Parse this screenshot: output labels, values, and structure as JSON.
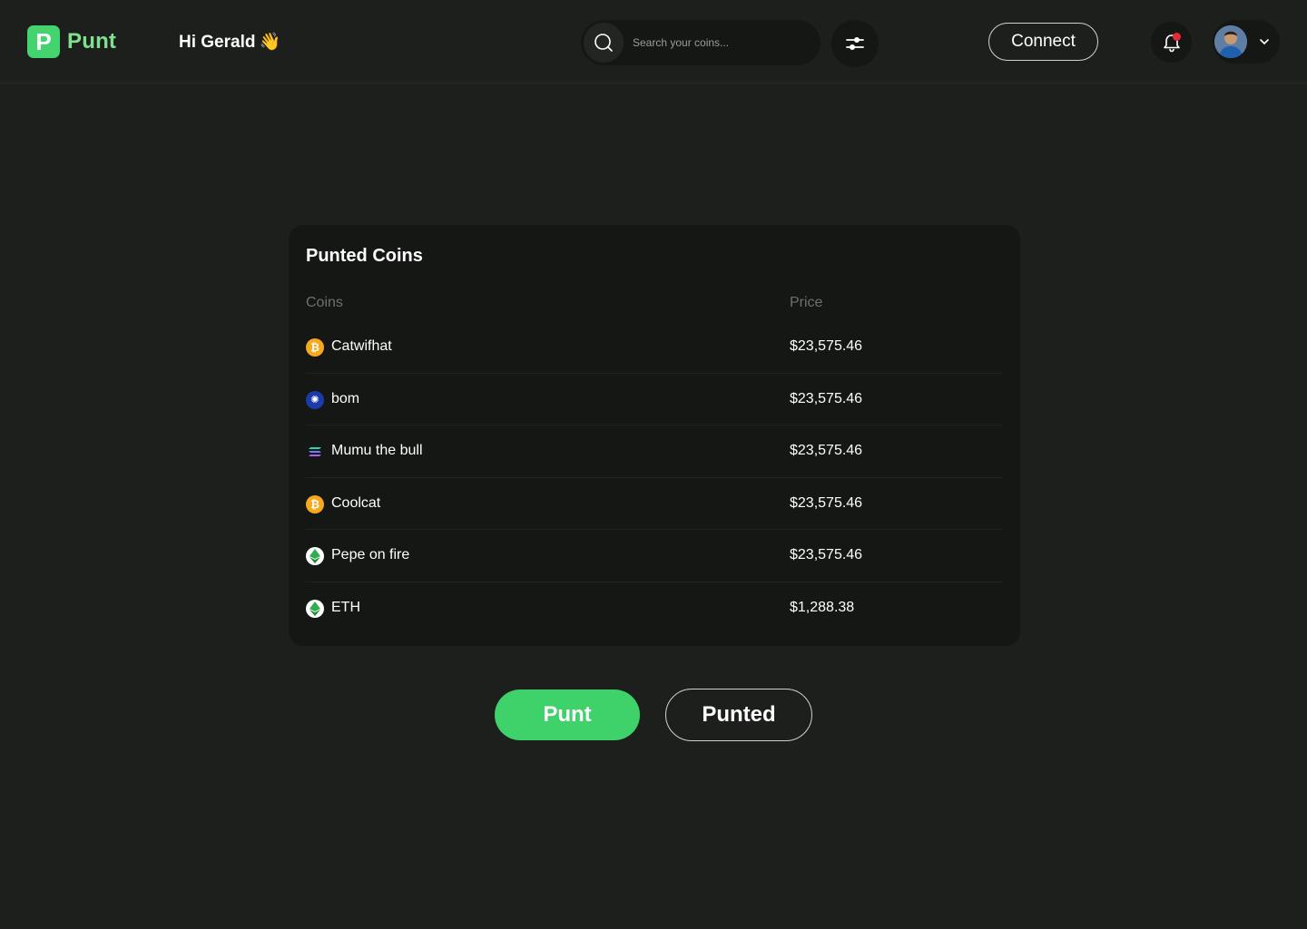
{
  "brand": {
    "logo_letter": "P",
    "name": "Punt"
  },
  "header": {
    "greeting": "Hi Gerald",
    "greeting_emoji": "👋",
    "search_placeholder": "Search your coins...",
    "connect_label": "Connect"
  },
  "card": {
    "title": "Punted Coins",
    "col_coins": "Coins",
    "col_price": "Price",
    "rows": [
      {
        "name": "Catwifhat",
        "price": "$23,575.46",
        "icon": "bitcoin-icon",
        "icon_color": "#f7a91d"
      },
      {
        "name": "bom",
        "price": "$23,575.46",
        "icon": "cardano-icon",
        "icon_color": "#1a3ba8"
      },
      {
        "name": "Mumu the bull",
        "price": "$23,575.46",
        "icon": "solana-icon",
        "icon_color": "#9b5cf2"
      },
      {
        "name": "Coolcat",
        "price": "$23,575.46",
        "icon": "bitcoin-icon",
        "icon_color": "#f7a91d"
      },
      {
        "name": "Pepe on fire",
        "price": "$23,575.46",
        "icon": "ethereum-icon",
        "icon_color": "#2eae4e"
      },
      {
        "name": "ETH",
        "price": "$1,288.38",
        "icon": "ethereum-icon",
        "icon_color": "#2eae4e"
      }
    ]
  },
  "actions": {
    "punt_label": "Punt",
    "punted_label": "Punted"
  },
  "colors": {
    "accent": "#3fd26b",
    "notification": "#e5283a",
    "background": "#1d1f1d"
  }
}
